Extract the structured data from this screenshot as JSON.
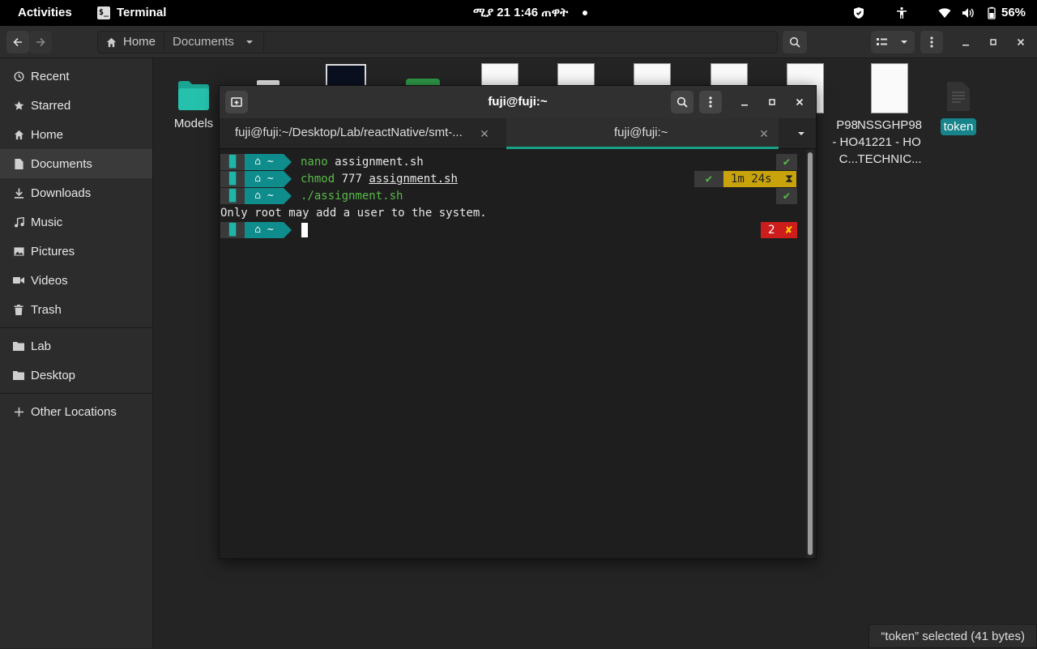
{
  "topbar": {
    "activities": "Activities",
    "app_name": "Terminal",
    "clock": "ሚያ 21  1:46 ጠዋት",
    "battery": "56%"
  },
  "file_manager": {
    "breadcrumbs": [
      "Home",
      "Documents"
    ],
    "sidebar": [
      {
        "label": "Recent",
        "icon": "clock-icon"
      },
      {
        "label": "Starred",
        "icon": "star-icon"
      },
      {
        "label": "Home",
        "icon": "home-icon"
      },
      {
        "label": "Documents",
        "icon": "document-icon"
      },
      {
        "label": "Downloads",
        "icon": "download-icon"
      },
      {
        "label": "Music",
        "icon": "music-icon"
      },
      {
        "label": "Pictures",
        "icon": "picture-icon"
      },
      {
        "label": "Videos",
        "icon": "video-icon"
      },
      {
        "label": "Trash",
        "icon": "trash-icon"
      },
      {
        "label": "Lab",
        "icon": "folder-icon"
      },
      {
        "label": "Desktop",
        "icon": "folder-icon"
      },
      {
        "label": "Other Locations",
        "icon": "plus-icon"
      }
    ],
    "files": {
      "models": "Models",
      "doc1_l1": "P98",
      "doc1_l2": "- HO",
      "doc1_l3": "C...",
      "doc2_l1": "NSSGHP98",
      "doc2_l2": "41221 - HO",
      "doc2_l3": "TECHNIC...",
      "token": "token"
    },
    "status": "“token” selected  (41 bytes)"
  },
  "terminal": {
    "title": "fuji@fuji:~",
    "tabs": [
      {
        "label": "fuji@fuji:~/Desktop/Lab/reactNative/smt-..."
      },
      {
        "label": "fuji@fuji:~"
      }
    ],
    "prompt_home": "~",
    "lines": {
      "l1_cmd": "nano",
      "l1_arg": " assignment.sh",
      "l2_cmd": "chmod",
      "l2_mid": " 777 ",
      "l2_arg": "assignment.sh",
      "l2_time": "1m 24s",
      "l3_cmd": "./assignment.sh",
      "output": "Only root may add a user to the system.",
      "err_code": "2"
    },
    "check": "✔",
    "cross": "✘"
  },
  "colors": {
    "accent": "#16848a",
    "prompt_teal": "#0f8c8c",
    "cmd_green": "#59b94a",
    "warn_yellow": "#c9a30b",
    "error_red": "#cc1c1c"
  }
}
